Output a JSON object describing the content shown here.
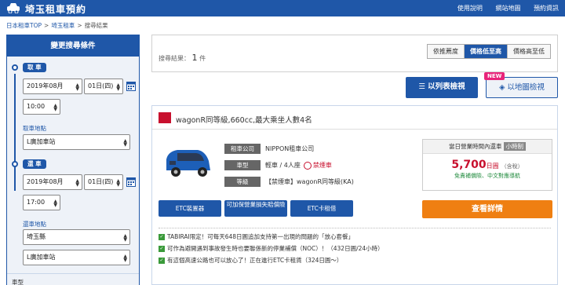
{
  "header": {
    "title": "埼玉租車預約",
    "links": [
      "使用說明",
      "網站地圖",
      "預約資訊"
    ]
  },
  "breadcrumb": [
    "日本租車TOP",
    "埼玉租車",
    "搜尋結果"
  ],
  "sidebar": {
    "title": "變更搜尋條件",
    "pickup_label": "取 車",
    "pickup_month": "2019年08月",
    "pickup_day": "01日(四)",
    "pickup_time": "10:00",
    "pickup_place_label": "取車地點",
    "pickup_place": "L廣加車站",
    "return_label": "還 車",
    "return_month": "2019年08月",
    "return_day": "01日(四)",
    "return_time": "17:00",
    "return_place_label": "還車地點",
    "return_pref": "埼玉縣",
    "return_place": "L廣加車站",
    "car_type_label": "車型"
  },
  "results": {
    "count_label": "搜尋結果：",
    "count": "1",
    "count_unit": "件",
    "sort_options": [
      "依推薦度",
      "價格低至高",
      "價格高至低"
    ],
    "active_sort": 1,
    "view_list": "以列表檢視",
    "view_map": "以地圖檢視",
    "new_badge": "NEW"
  },
  "card": {
    "title": "wagonR同等級,660cc,最大乘坐人數4名",
    "rows": [
      {
        "k": "租車公司",
        "v": "NIPPON租車公司"
      },
      {
        "k": "車型",
        "v": "輕車 / 4人座"
      },
      {
        "k": "等級",
        "v": "【禁煙車】wagonR同等級(KA)"
      }
    ],
    "no_smoke": "禁煙車",
    "price_head": "當日營業時間內還車",
    "price_tag": "小時制",
    "price": "5,700",
    "price_unit": "日圓",
    "price_tax": "（含稅）",
    "price_note": "免責補償險、中文對應導航",
    "options": [
      "ETC裝置器",
      "可加保營業損失賠償險",
      "ETC卡租借"
    ],
    "detail": "查看詳情",
    "notes": [
      "TABIRAI限定！可每天648日圓追加支持第一出現的問題的「放心套餐」",
      "可作為避開遇到事故發生時也要聯係新的停業補償（NOC）！（432日圓/24小時）",
      "有這個高速公路也可以放心了！正在進行ETC卡租賃（324日圓～）"
    ]
  },
  "colors": {
    "brand": "#1f57a8",
    "accent": "#ef7f12",
    "price": "#c8102e",
    "new": "#e8247a"
  }
}
